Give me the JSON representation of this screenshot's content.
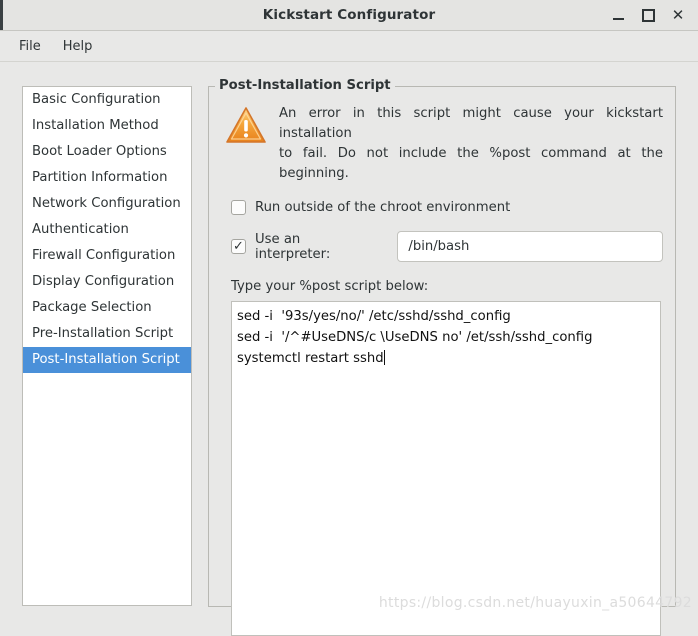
{
  "window": {
    "title": "Kickstart Configurator",
    "controls": {
      "minimize": "minimize-icon",
      "maximize": "maximize-icon",
      "close": "✕"
    }
  },
  "menubar": {
    "items": [
      {
        "label": "File"
      },
      {
        "label": "Help"
      }
    ]
  },
  "sidebar": {
    "items": [
      {
        "label": "Basic Configuration",
        "selected": false
      },
      {
        "label": "Installation Method",
        "selected": false
      },
      {
        "label": "Boot Loader Options",
        "selected": false
      },
      {
        "label": "Partition Information",
        "selected": false
      },
      {
        "label": "Network Configuration",
        "selected": false
      },
      {
        "label": "Authentication",
        "selected": false
      },
      {
        "label": "Firewall Configuration",
        "selected": false
      },
      {
        "label": "Display Configuration",
        "selected": false
      },
      {
        "label": "Package Selection",
        "selected": false
      },
      {
        "label": "Pre-Installation Script",
        "selected": false
      },
      {
        "label": "Post-Installation Script",
        "selected": true
      }
    ]
  },
  "panel": {
    "legend": "Post-Installation Script",
    "warning": {
      "icon": "warning-triangle-icon",
      "line1": "An error in this script might cause your kickstart installation",
      "line2": "to fail. Do not include the %post command at the beginning."
    },
    "chroot_checkbox": {
      "label": "Run outside of the chroot environment",
      "checked": false
    },
    "interpreter_checkbox": {
      "label": "Use an interpreter:",
      "checked": true
    },
    "interpreter_input": {
      "value": "/bin/bash",
      "placeholder": ""
    },
    "script_label": "Type your %post script below:",
    "script_lines": [
      "sed -i  '93s/yes/no/' /etc/sshd/sshd_config",
      "sed -i  '/^#UseDNS/c \\UseDNS no' /et/ssh/sshd_config",
      "systemctl restart sshd"
    ]
  },
  "watermark": {
    "text": "https://blog.csdn.net/huayuxin_a50644792"
  },
  "colors": {
    "selection_blue": "#4a90d9",
    "window_background": "#e8e8e7",
    "warning_orange": "#f08c28"
  }
}
